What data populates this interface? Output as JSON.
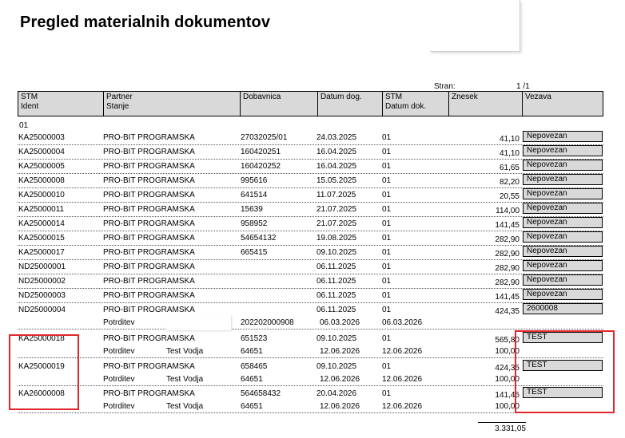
{
  "title": "Pregled materialnih dokumentov",
  "pagination": {
    "label": "Stran:",
    "value": "1 /1"
  },
  "headers": [
    {
      "line1": "STM",
      "line2": "Ident"
    },
    {
      "line1": "Partner",
      "line2": "Stanje"
    },
    {
      "line1": "Dobavnica",
      "line2": ""
    },
    {
      "line1": "Datum dog.",
      "line2": ""
    },
    {
      "line1": "STM",
      "line2": "Datum dok."
    },
    {
      "line1": "Znesek",
      "line2": ""
    },
    {
      "line1": "Vezava",
      "line2": ""
    }
  ],
  "group": "01",
  "rows": [
    {
      "ident": "KA25000003",
      "partner": "PRO-BIT PROGRAMSKA",
      "dobavnica": "27032025/01",
      "datum": "24.03.2025",
      "stm": "01",
      "znesek": "41,10",
      "vezava": "Nepovezan"
    },
    {
      "ident": "KA25000004",
      "partner": "PRO-BIT PROGRAMSKA",
      "dobavnica": "160420251",
      "datum": "16.04.2025",
      "stm": "01",
      "znesek": "41,10",
      "vezava": "Nepovezan"
    },
    {
      "ident": "KA25000005",
      "partner": "PRO-BIT PROGRAMSKA",
      "dobavnica": "160420252",
      "datum": "16.04.2025",
      "stm": "01",
      "znesek": "61,65",
      "vezava": "Nepovezan"
    },
    {
      "ident": "KA25000008",
      "partner": "PRO-BIT PROGRAMSKA",
      "dobavnica": "995616",
      "datum": "15.05.2025",
      "stm": "01",
      "znesek": "82,20",
      "vezava": "Nepovezan"
    },
    {
      "ident": "KA25000010",
      "partner": "PRO-BIT PROGRAMSKA",
      "dobavnica": "641514",
      "datum": "11.07.2025",
      "stm": "01",
      "znesek": "20,55",
      "vezava": "Nepovezan"
    },
    {
      "ident": "KA25000011",
      "partner": "PRO-BIT PROGRAMSKA",
      "dobavnica": "15639",
      "datum": "21.07.2025",
      "stm": "01",
      "znesek": "114,00",
      "vezava": "Nepovezan"
    },
    {
      "ident": "KA25000014",
      "partner": "PRO-BIT PROGRAMSKA",
      "dobavnica": "958952",
      "datum": "21.07.2025",
      "stm": "01",
      "znesek": "141,45",
      "vezava": "Nepovezan"
    },
    {
      "ident": "KA25000015",
      "partner": "PRO-BIT PROGRAMSKA",
      "dobavnica": "54654132",
      "datum": "19.08.2025",
      "stm": "01",
      "znesek": "282,90",
      "vezava": "Nepovezan"
    },
    {
      "ident": "KA25000017",
      "partner": "PRO-BIT PROGRAMSKA",
      "dobavnica": "665415",
      "datum": "09.10.2025",
      "stm": "01",
      "znesek": "282,90",
      "vezava": "Nepovezan"
    },
    {
      "ident": "ND25000001",
      "partner": "PRO-BIT PROGRAMSKA",
      "dobavnica": "",
      "datum": "06.11.2025",
      "stm": "01",
      "znesek": "282,90",
      "vezava": "Nepovezan"
    },
    {
      "ident": "ND25000002",
      "partner": "PRO-BIT PROGRAMSKA",
      "dobavnica": "",
      "datum": "06.11.2025",
      "stm": "01",
      "znesek": "282,90",
      "vezava": "Nepovezan"
    },
    {
      "ident": "ND25000003",
      "partner": "PRO-BIT PROGRAMSKA",
      "dobavnica": "",
      "datum": "06.11.2025",
      "stm": "01",
      "znesek": "141,45",
      "vezava": "Nepovezan"
    },
    {
      "ident": "ND25000004",
      "partner": "PRO-BIT PROGRAMSKA",
      "dobavnica": "",
      "datum": "06.11.2025",
      "stm": "01",
      "znesek": "424,35",
      "vezava": "2600008",
      "sub": {
        "stanje": "Potrditev",
        "vodja": "",
        "dobavnica": "202202000908",
        "datum": "06.03.2026",
        "datum_dok": "06.03.2026",
        "znesek": ""
      }
    },
    {
      "ident": "KA25000018",
      "partner": "PRO-BIT PROGRAMSKA",
      "dobavnica": "651523",
      "datum": "09.10.2025",
      "stm": "01",
      "znesek": "565,80",
      "vezava": "TEST",
      "sub": {
        "stanje": "Potrditev",
        "vodja": "Test Vodja",
        "dobavnica": "64651",
        "datum": "12.06.2026",
        "datum_dok": "12.06.2026",
        "znesek": "100,00"
      }
    },
    {
      "ident": "KA25000019",
      "partner": "PRO-BIT PROGRAMSKA",
      "dobavnica": "658465",
      "datum": "09.10.2025",
      "stm": "01",
      "znesek": "424,35",
      "vezava": "TEST",
      "sub": {
        "stanje": "Potrditev",
        "vodja": "Test Vodja",
        "dobavnica": "64651",
        "datum": "12.06.2026",
        "datum_dok": "12.06.2026",
        "znesek": "100,00"
      }
    },
    {
      "ident": "KA26000008",
      "partner": "PRO-BIT PROGRAMSKA",
      "dobavnica": "564658432",
      "datum": "20.04.2026",
      "stm": "01",
      "znesek": "141,45",
      "vezava": "TEST",
      "sub": {
        "stanje": "Potrditev",
        "vodja": "Test Vodja",
        "dobavnica": "64651",
        "datum": "12.06.2026",
        "datum_dok": "12.06.2026",
        "znesek": "100,00"
      }
    }
  ],
  "total": "3.331,05",
  "colors": {
    "header_bg": "#d9d9d9",
    "highlight": "#e0262b"
  }
}
